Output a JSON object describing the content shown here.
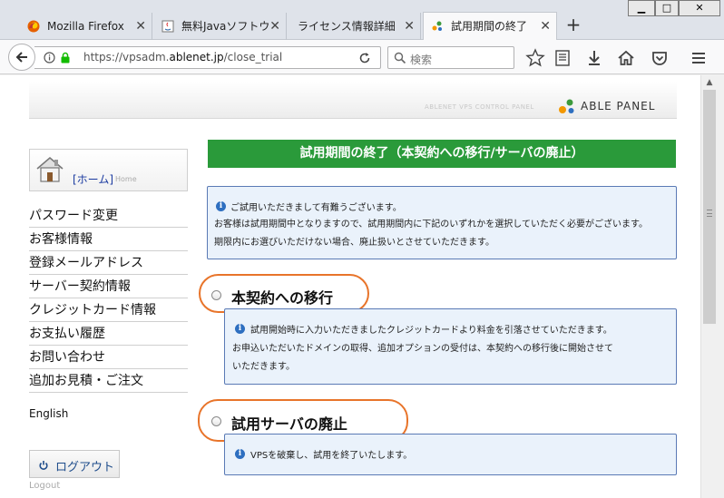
{
  "browser": {
    "tabs": [
      {
        "label": "Mozilla Firefox"
      },
      {
        "label": "無料Javaソフトウ"
      },
      {
        "label": "ライセンス情報詳細"
      },
      {
        "label": "試用期間の終了"
      }
    ],
    "url": {
      "prefix": "https://vpsadm.",
      "domain": "ablenet.jp",
      "path": "/close_trial"
    },
    "search_placeholder": "検索"
  },
  "header": {
    "subtitle": "ABLENET VPS CONTROL PANEL",
    "logo": "ABLE PANEL"
  },
  "sidebar": {
    "home_label": "[ホーム]",
    "home_sub": "Home",
    "items": [
      {
        "label": "パスワード変更"
      },
      {
        "label": "お客様情報"
      },
      {
        "label": "登録メールアドレス"
      },
      {
        "label": "サーバー契約情報"
      },
      {
        "label": "クレジットカード情報"
      },
      {
        "label": "お支払い履歴"
      },
      {
        "label": "お問い合わせ"
      },
      {
        "label": "追加お見積・ご注文"
      }
    ],
    "english": "English",
    "logout_label": "ログアウト",
    "logout_sub": "Logout"
  },
  "main": {
    "heading": "試用期間の終了（本契約への移行/サーバの廃止）",
    "intro": {
      "line1": "ご試用いただきまして有難うございます。",
      "line2": "お客様は試用期間中となりますので、試用期間内に下記のいずれかを選択していただく必要がございます。",
      "line3": "期限内にお選びいただけない場合、廃止扱いとさせていただきます。"
    },
    "option1": {
      "title": "本契約への移行",
      "line1": "試用開始時に入力いただきましたクレジットカードより料金を引落させていただきます。",
      "line2": "お申込いただいたドメインの取得、追加オプションの受付は、本契約への移行後に開始させて",
      "line3": "いただきます。"
    },
    "option2": {
      "title": "試用サーバの廃止",
      "line1": "VPSを破棄し、試用を終了いたします。"
    }
  },
  "colors": {
    "heading_green": "#2a9a3a",
    "highlight_orange": "#e8742a",
    "info_blue": "#2e6fc0"
  }
}
